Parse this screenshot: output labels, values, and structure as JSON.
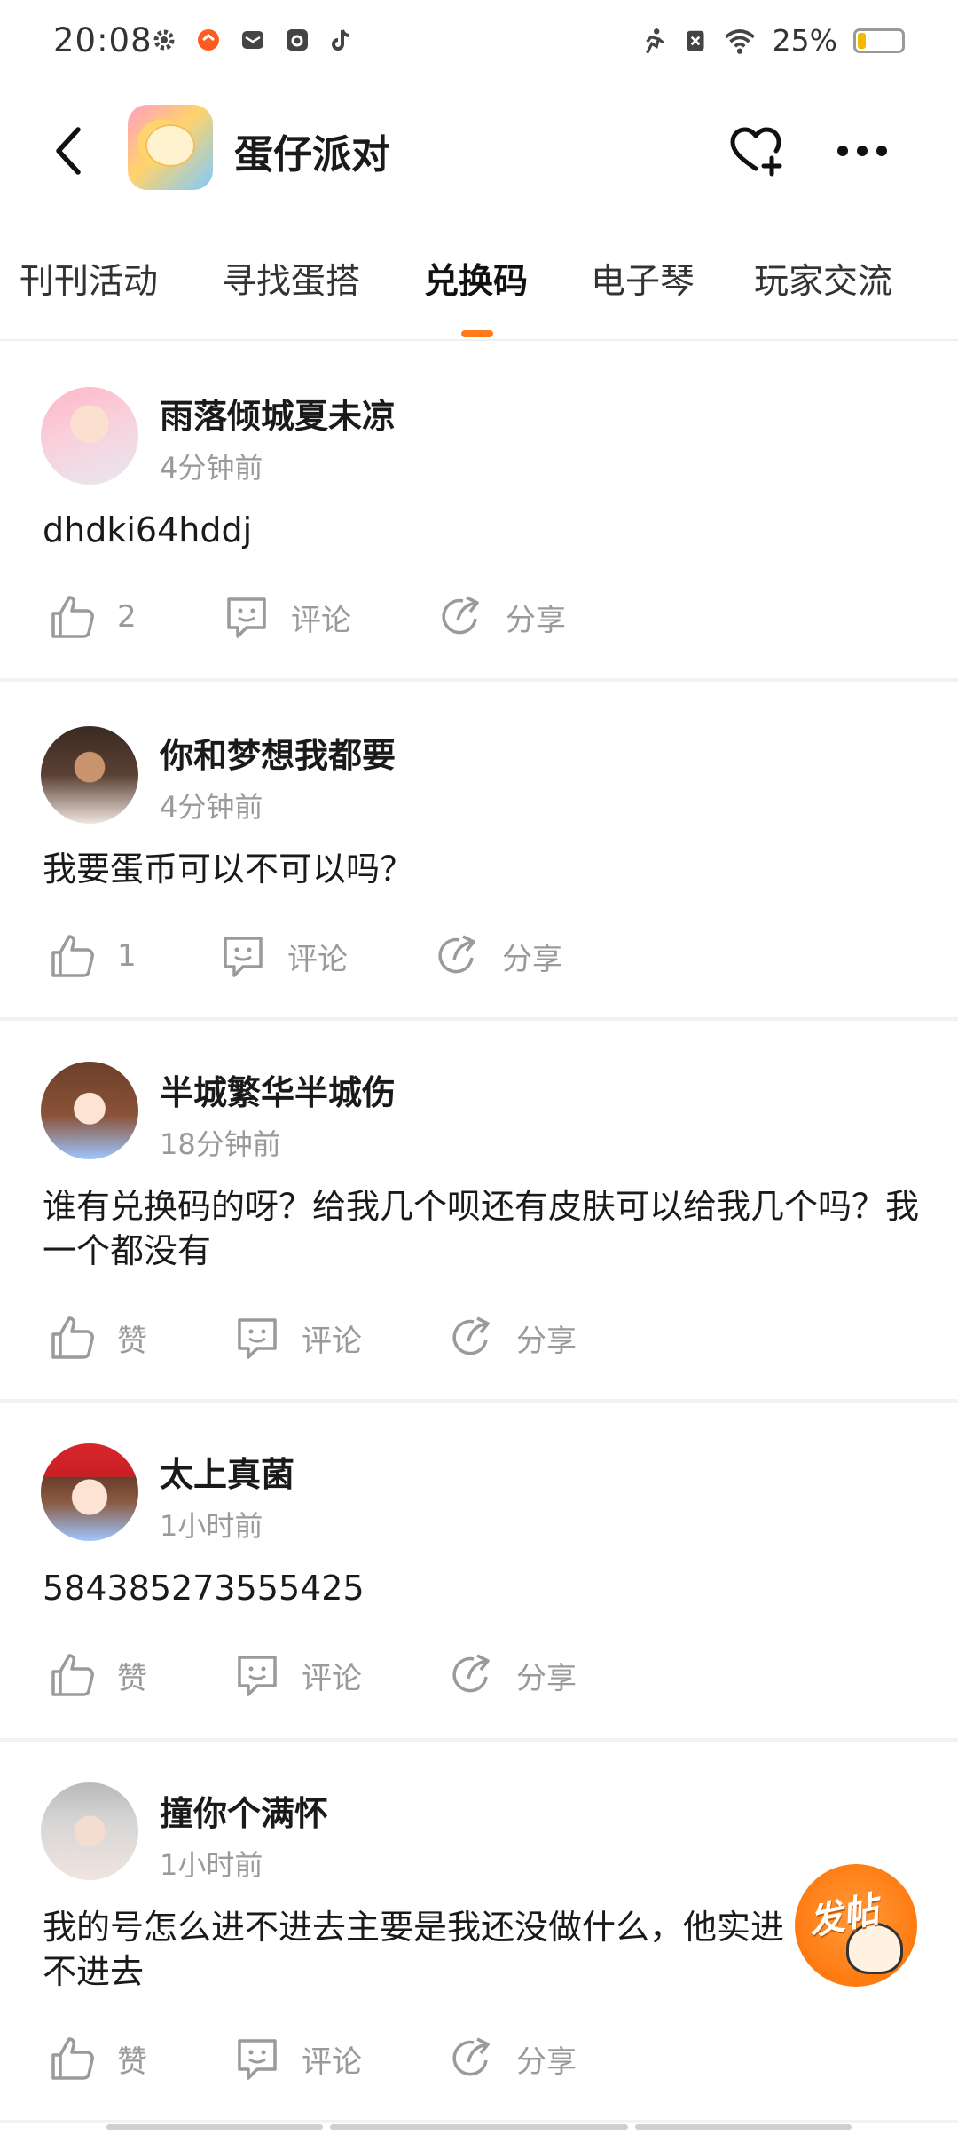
{
  "status_bar": {
    "time": "20:08",
    "battery_percent": "25%",
    "battery_level": 0.25,
    "icons_left": [
      "settings-icon",
      "notification-app-icon",
      "mail-icon",
      "camera-app-icon",
      "tiktok-icon"
    ],
    "icons_right": [
      "activity-icon",
      "sim-icon",
      "wifi-icon",
      "battery-icon"
    ]
  },
  "header": {
    "title": "蛋仔派对",
    "back_icon": "chevron-left-icon",
    "follow_icon": "heart-plus-icon",
    "more_icon": "more-dots-icon"
  },
  "tabs": [
    {
      "label": "刊刊活动",
      "active": false
    },
    {
      "label": "寻找蛋搭",
      "active": false
    },
    {
      "label": "兑换码",
      "active": true
    },
    {
      "label": "电子琴",
      "active": false
    },
    {
      "label": "玩家交流",
      "active": false
    }
  ],
  "posts": [
    {
      "username": "雨落倾城夏未凉",
      "time": "4分钟前",
      "content": "dhdki64hddj",
      "like_label": "2",
      "comment_label": "评论",
      "share_label": "分享"
    },
    {
      "username": "你和梦想我都要",
      "time": "4分钟前",
      "content": "我要蛋币可以不可以吗？",
      "like_label": "1",
      "comment_label": "评论",
      "share_label": "分享"
    },
    {
      "username": "半城繁华半城伤",
      "time": "18分钟前",
      "content": "谁有兑换码的呀？给我几个呗还有皮肤可以给我几个吗？我一个都没有",
      "like_label": "赞",
      "comment_label": "评论",
      "share_label": "分享"
    },
    {
      "username": "太上真菌",
      "time": "1小时前",
      "content": "584385273555425",
      "like_label": "赞",
      "comment_label": "评论",
      "share_label": "分享"
    },
    {
      "username": "撞你个满怀",
      "time": "1小时前",
      "content": "我的号怎么进不进去主要是我还没做什么，他实进不进去",
      "like_label": "赞",
      "comment_label": "评论",
      "share_label": "分享"
    }
  ],
  "fab": {
    "label": "发帖"
  },
  "colors": {
    "accent": "#ff7a1a",
    "muted": "#9a9a9a",
    "divider": "#f2f2f2"
  }
}
